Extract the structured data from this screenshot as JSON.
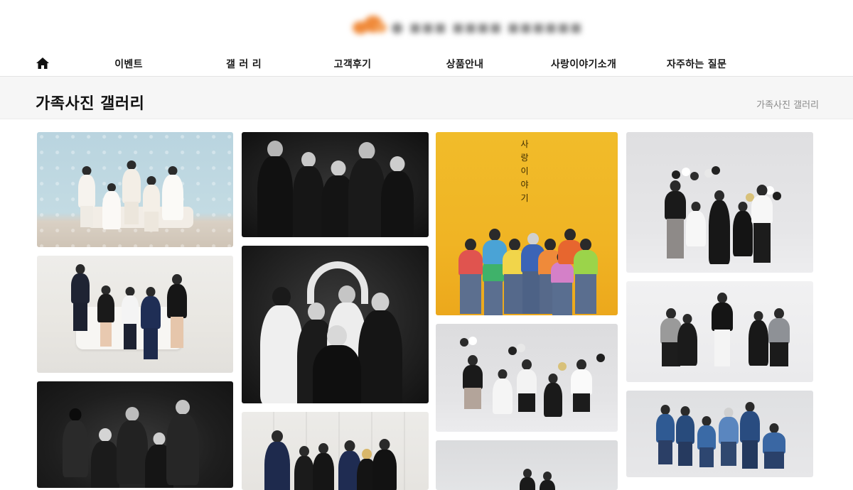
{
  "header": {
    "logo_text": "",
    "nav": [
      {
        "id": "events",
        "label": "이벤트",
        "center": 181
      },
      {
        "id": "gallery",
        "label": "갤 러 리",
        "center": 343
      },
      {
        "id": "reviews",
        "label": "고객후기",
        "center": 496
      },
      {
        "id": "products",
        "label": "상품안내",
        "center": 654
      },
      {
        "id": "about",
        "label": "사랑이야기소개",
        "center": 821
      },
      {
        "id": "faq",
        "label": "자주하는 질문",
        "center": 980
      }
    ]
  },
  "page": {
    "title": "가족사진 갤러리",
    "breadcrumb": "가족사진 갤러리"
  },
  "gallery": {
    "tile_3_vertical_text": "사랑이야기",
    "colors": {
      "light_blue_backdrop": "#b8d3de",
      "mono_dark": "#1c1c1c",
      "mono_mid": "#9a9a9a",
      "warm_white": "#ecebe8",
      "yellow_backdrop": "#f2b722",
      "studio_grey": "#d8d8da"
    }
  }
}
